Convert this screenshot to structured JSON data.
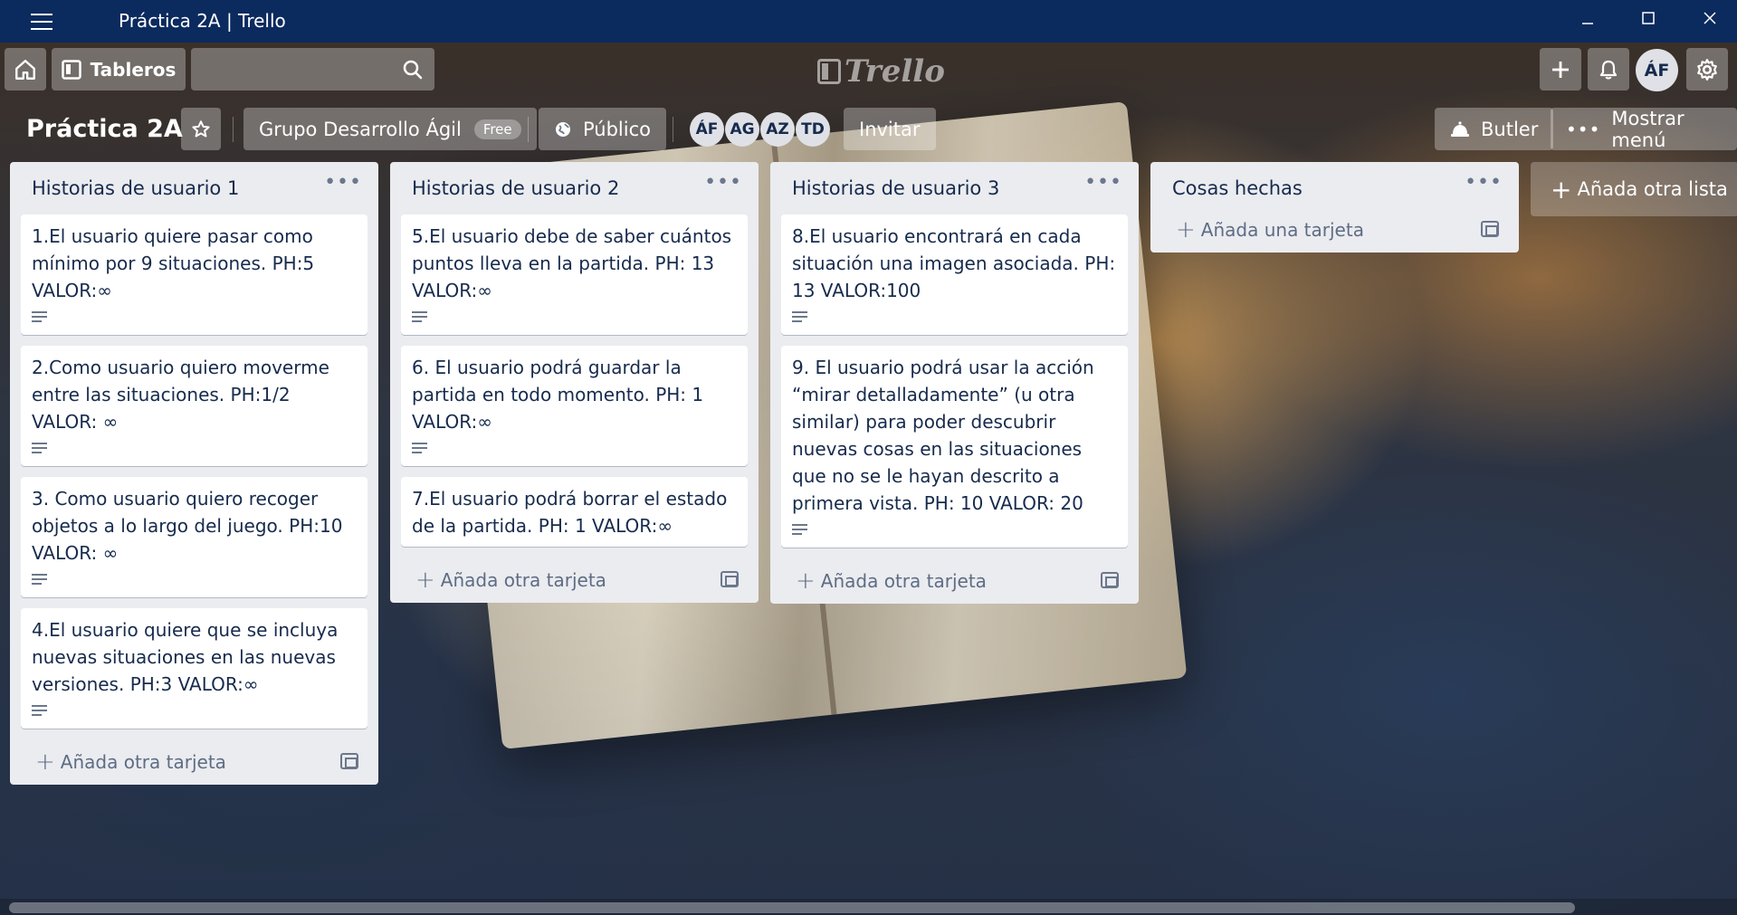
{
  "window": {
    "title": "Práctica 2A | Trello"
  },
  "header": {
    "boards_label": "Tableros",
    "search_value": "",
    "logo_text": "Trello",
    "user_initials": "ÁF"
  },
  "board": {
    "title": "Práctica 2A",
    "team_name": "Grupo Desarrollo Ágil",
    "team_badge": "Free",
    "visibility": "Público",
    "members": [
      "ÁF",
      "AG",
      "AZ",
      "TD"
    ],
    "invite_label": "Invitar",
    "butler_label": "Butler",
    "menu_label": "Mostrar menú"
  },
  "lists": [
    {
      "title": "Historias de usuario 1",
      "cards": [
        "1.El usuario quiere pasar como mínimo por 9 situaciones. PH:5 VALOR:∞",
        "2.Como usuario quiero moverme entre las situaciones. PH:1/2 VALOR: ∞",
        "3. Como usuario quiero recoger objetos a lo largo del juego. PH:10 VALOR: ∞",
        "4.El usuario quiere que se incluya nuevas situaciones en las nuevas versiones. PH:3 VALOR:∞"
      ],
      "add_label": "Añada otra tarjeta"
    },
    {
      "title": "Historias de usuario 2",
      "cards": [
        "5.El usuario debe de saber cuántos puntos lleva en la partida. PH: 13 VALOR:∞",
        "6. El usuario podrá guardar la partida en todo momento. PH: 1 VALOR:∞",
        "7.El usuario podrá borrar el estado de la partida. PH: 1 VALOR:∞"
      ],
      "add_label": "Añada otra tarjeta"
    },
    {
      "title": "Historias de usuario 3",
      "cards": [
        "8.El usuario encontrará en cada situación una imagen asociada. PH: 13 VALOR:100",
        "9. El usuario podrá usar la acción “mirar detalladamente” (u otra similar) para poder descubrir nuevas cosas en las situaciones que no se le hayan descrito a primera vista. PH: 10 VALOR: 20"
      ],
      "add_label": "Añada otra tarjeta"
    },
    {
      "title": "Cosas hechas",
      "cards": [],
      "add_label": "Añada una tarjeta"
    }
  ],
  "add_list_label": "Añada otra lista",
  "colors": {
    "titlebar": "#0b2a5e",
    "list_bg": "#ebecf0",
    "card_text": "#172b4d"
  },
  "icons": {
    "hamburger": "hamburger-icon",
    "home": "home-icon",
    "boards": "board-icon",
    "search": "search-icon",
    "add": "plus-icon",
    "notifications": "bell-icon",
    "settings": "gear-icon",
    "star": "star-icon",
    "globe": "globe-icon",
    "butler": "bell-icon",
    "more": "ellipsis-icon",
    "description": "description-icon",
    "template": "template-icon"
  }
}
